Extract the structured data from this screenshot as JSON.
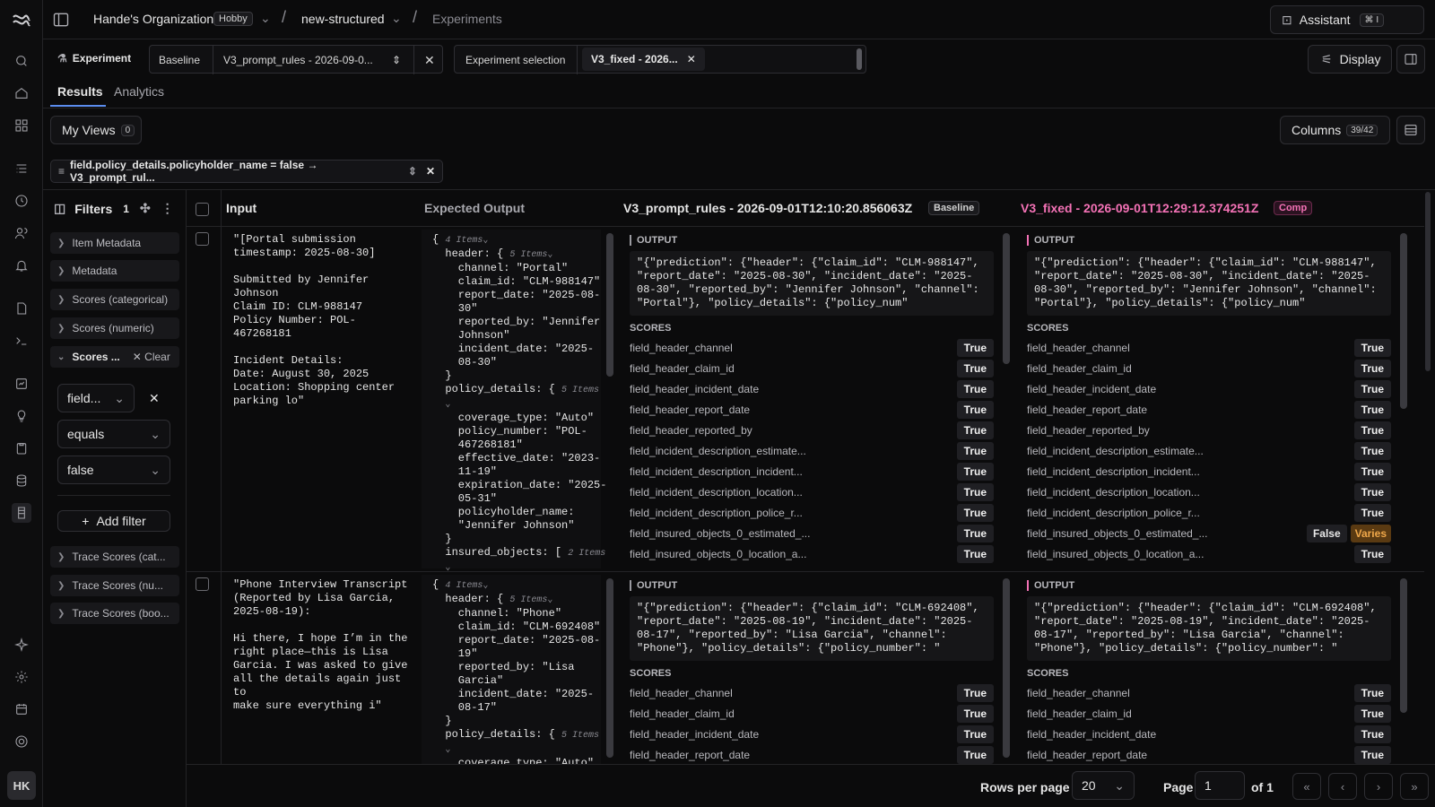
{
  "header": {
    "org": "Hande's Organization",
    "plan": "Hobby",
    "project": "new-structured",
    "section": "Experiments",
    "assistant_label": "Assistant",
    "assistant_shortcut": "⌘ I",
    "avatar": "HK"
  },
  "toolbar": {
    "experiment_label": "Experiment",
    "baseline_label": "Baseline",
    "baseline_value": "V3_prompt_rules - 2026-09-0...",
    "selection_label": "Experiment selection",
    "selection_chip": "V3_fixed - 2026...",
    "display_label": "Display"
  },
  "tabs": [
    "Results",
    "Analytics"
  ],
  "views": {
    "label": "My Views",
    "count": "0"
  },
  "columns_btn": {
    "label": "Columns",
    "count": "39/42"
  },
  "active_filter": "field.policy_details.policyholder_name = false → V3_prompt_rul...",
  "filters_panel": {
    "title": "Filters",
    "count": "1",
    "sections": [
      "Item Metadata",
      "Metadata",
      "Scores (categorical)",
      "Scores (numeric)"
    ],
    "open_section": "Scores ...",
    "clear_label": "Clear",
    "field_value": "field...",
    "operator_value": "equals",
    "value_value": "false",
    "add_filter": "Add filter",
    "trace_sections": [
      "Trace Scores (cat...",
      "Trace Scores (nu...",
      "Trace Scores (boo..."
    ]
  },
  "grid": {
    "columns": {
      "input": "Input",
      "expected": "Expected Output",
      "baseline_name": "V3_prompt_rules - 2026-09-01T12:10:20.856063Z",
      "baseline_badge": "Baseline",
      "comp_name": "V3_fixed - 2026-09-01T12:29:12.374251Z",
      "comp_badge": "Comp"
    },
    "labels": {
      "output": "OUTPUT",
      "scores": "SCORES"
    },
    "rows": [
      {
        "input": "\"[Portal submission\ntimestamp: 2025-08-30]\n\nSubmitted by Jennifer Johnson\nClaim ID: CLM-988147\nPolicy Number: POL-467268181\n\nIncident Details:\nDate: August 30, 2025\nLocation: Shopping center\nparking lo\"",
        "expected_lines": [
          "{ <i>4 Items⌄</i>",
          "  header: { <i>5 Items⌄</i>",
          "    channel: \"Portal\"",
          "    claim_id: \"CLM-988147\"",
          "    report_date: \"2025-08-",
          "    30\"",
          "    reported_by: \"Jennifer",
          "    Johnson\"",
          "    incident_date: \"2025-",
          "    08-30\"",
          "  }",
          "  policy_details: { <i>5 Items</i>",
          "  <i>⌄</i>",
          "    coverage_type: \"Auto\"",
          "    policy_number: \"POL-",
          "    467268181\"",
          "    effective_date: \"2023-",
          "    11-19\"",
          "    expiration_date: \"2025-",
          "    05-31\"",
          "    policyholder_name:",
          "    \"Jennifer Johnson\"",
          "  }",
          "  insured_objects: [ <i>2 Items</i>",
          "  <i>⌄</i>"
        ],
        "baseline_output": "\"{\"prediction\": {\"header\": {\"claim_id\": \"CLM-988147\", \"report_date\": \"2025-08-30\", \"incident_date\": \"2025-08-30\", \"reported_by\": \"Jennifer Johnson\", \"channel\": \"Portal\"}, \"policy_details\": {\"policy_num\"",
        "comp_output": "\"{\"prediction\": {\"header\": {\"claim_id\": \"CLM-988147\", \"report_date\": \"2025-08-30\", \"incident_date\": \"2025-08-30\", \"reported_by\": \"Jennifer Johnson\", \"channel\": \"Portal\"}, \"policy_details\": {\"policy_num\"",
        "scores": [
          {
            "name": "field_header_channel",
            "base": "True",
            "comp": "True"
          },
          {
            "name": "field_header_claim_id",
            "base": "True",
            "comp": "True"
          },
          {
            "name": "field_header_incident_date",
            "base": "True",
            "comp": "True"
          },
          {
            "name": "field_header_report_date",
            "base": "True",
            "comp": "True"
          },
          {
            "name": "field_header_reported_by",
            "base": "True",
            "comp": "True"
          },
          {
            "name": "field_incident_description_estimate...",
            "base": "True",
            "comp": "True"
          },
          {
            "name": "field_incident_description_incident...",
            "base": "True",
            "comp": "True"
          },
          {
            "name": "field_incident_description_location...",
            "base": "True",
            "comp": "True"
          },
          {
            "name": "field_incident_description_police_r...",
            "base": "True",
            "comp": "True"
          },
          {
            "name": "field_insured_objects_0_estimated_...",
            "base": "True",
            "comp": "False",
            "varies": "Varies"
          },
          {
            "name": "field_insured_objects_0_location_a...",
            "base": "True",
            "comp": "True"
          }
        ]
      },
      {
        "input": "\"Phone Interview Transcript\n(Reported by Lisa Garcia,\n2025-08-19):\n\nHi there, I hope I’m in the\nright place—this is Lisa\nGarcia. I was asked to give\nall the details again just to\nmake sure everything i\"",
        "expected_lines": [
          "{ <i>4 Items⌄</i>",
          "  header: { <i>5 Items⌄</i>",
          "    channel: \"Phone\"",
          "    claim_id: \"CLM-692408\"",
          "    report_date: \"2025-08-",
          "    19\"",
          "    reported_by: \"Lisa",
          "    Garcia\"",
          "    incident_date: \"2025-",
          "    08-17\"",
          "  }",
          "  policy_details: { <i>5 Items</i>",
          "  <i>⌄</i>",
          "    coverage_type: \"Auto\""
        ],
        "baseline_output": "\"{\"prediction\": {\"header\": {\"claim_id\": \"CLM-692408\", \"report_date\": \"2025-08-19\", \"incident_date\": \"2025-08-17\", \"reported_by\": \"Lisa Garcia\", \"channel\": \"Phone\"}, \"policy_details\": {\"policy_number\": \"",
        "comp_output": "\"{\"prediction\": {\"header\": {\"claim_id\": \"CLM-692408\", \"report_date\": \"2025-08-19\", \"incident_date\": \"2025-08-17\", \"reported_by\": \"Lisa Garcia\", \"channel\": \"Phone\"}, \"policy_details\": {\"policy_number\": \"",
        "scores": [
          {
            "name": "field_header_channel",
            "base": "True",
            "comp": "True"
          },
          {
            "name": "field_header_claim_id",
            "base": "True",
            "comp": "True"
          },
          {
            "name": "field_header_incident_date",
            "base": "True",
            "comp": "True"
          },
          {
            "name": "field_header_report_date",
            "base": "True",
            "comp": "True"
          }
        ]
      }
    ]
  },
  "footer": {
    "rows_per_page_label": "Rows per page",
    "rows_per_page_value": "20",
    "page_label": "Page",
    "page_value": "1",
    "of_label": "of 1"
  },
  "colors": {
    "accent_pink": "#f472b6",
    "varies_bg": "#5a3a12",
    "varies_fg": "#f0a84a"
  }
}
